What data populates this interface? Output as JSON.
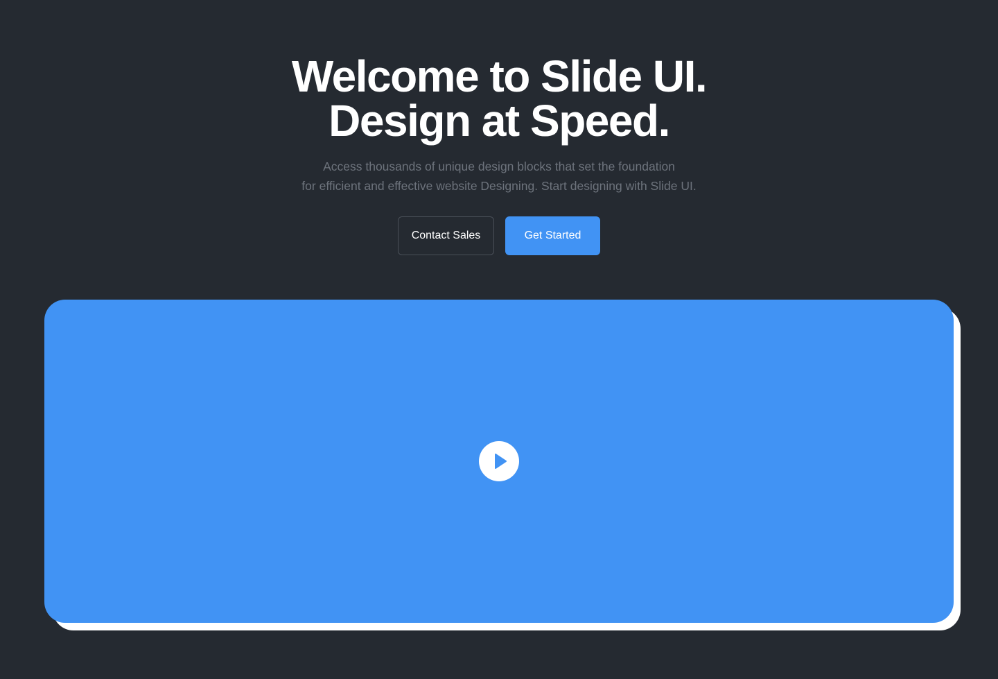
{
  "hero": {
    "title_line1": "Welcome to Slide UI.",
    "title_line2": "Design at Speed.",
    "subtitle_line1": "Access thousands of unique design blocks that set the foundation",
    "subtitle_line2": "for efficient and effective website Designing. Start designing with Slide UI."
  },
  "actions": {
    "contact_label": "Contact Sales",
    "get_started_label": "Get Started"
  },
  "media": {
    "play_icon": "play-icon"
  },
  "colors": {
    "background": "#252a31",
    "accent": "#4193f4",
    "subtitle_text": "#6d737c"
  }
}
